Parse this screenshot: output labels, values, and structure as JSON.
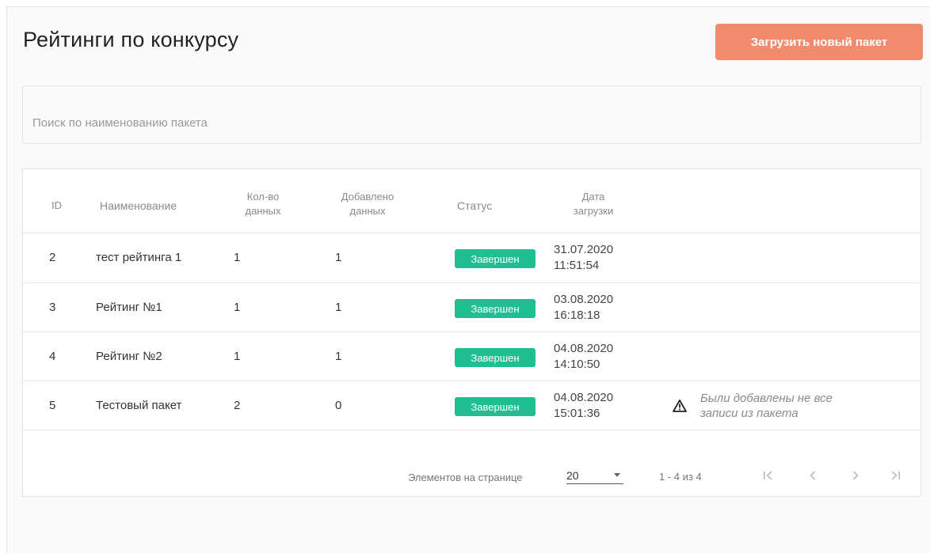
{
  "page": {
    "title": "Рейтинги по конкурсу",
    "upload_button_label": "Загрузить новый пакет"
  },
  "search": {
    "placeholder": "Поиск по наименованию пакета",
    "value": ""
  },
  "table": {
    "headers": {
      "id": "ID",
      "name": "Наименование",
      "count_line1": "Кол-во",
      "count_line2": "данных",
      "added_line1": "Добавлено",
      "added_line2": "данных",
      "status": "Статус",
      "date_line1": "Дата",
      "date_line2": "загрузки"
    },
    "rows": [
      {
        "id": "2",
        "name": "тест рейтинга 1",
        "count": "1",
        "added": "1",
        "status": "Завершен",
        "date": "31.07.2020",
        "time": "11:51:54",
        "note": ""
      },
      {
        "id": "3",
        "name": "Рейтинг №1",
        "count": "1",
        "added": "1",
        "status": "Завершен",
        "date": "03.08.2020",
        "time": "16:18:18",
        "note": ""
      },
      {
        "id": "4",
        "name": "Рейтинг №2",
        "count": "1",
        "added": "1",
        "status": "Завершен",
        "date": "04.08.2020",
        "time": "14:10:50",
        "note": ""
      },
      {
        "id": "5",
        "name": "Тестовый пакет",
        "count": "2",
        "added": "0",
        "status": "Завершен",
        "date": "04.08.2020",
        "time": "15:01:36",
        "note_line1": "Были добавлены не все",
        "note_line2": "записи из пакета"
      }
    ]
  },
  "paginator": {
    "items_per_page_label": "Элементов на странице",
    "page_size": "20",
    "range_label": "1 - 4 из 4"
  },
  "colors": {
    "accent_button": "#f28b6e",
    "status_done": "#1fbf91"
  },
  "icons": {
    "warning": "warning-icon",
    "first_page": "first-page-icon",
    "prev_page": "prev-page-icon",
    "next_page": "next-page-icon",
    "last_page": "last-page-icon",
    "select_caret": "chevron-down-icon"
  }
}
